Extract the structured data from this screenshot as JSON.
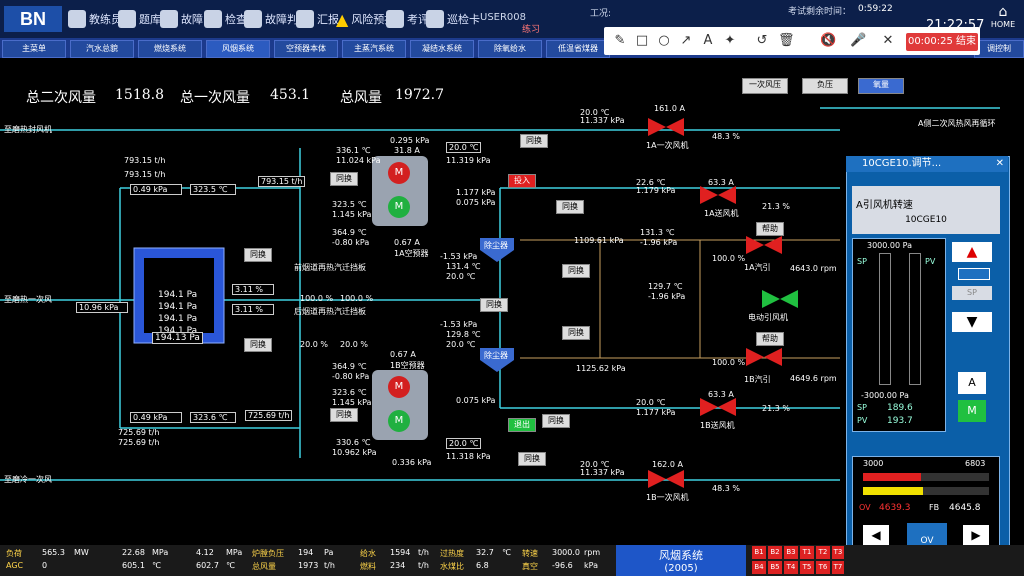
{
  "topbar": {
    "logo": "BN",
    "buttons": [
      "教练员站",
      "题库",
      "故障",
      "检查",
      "故障判断",
      "汇报",
      "风险预控",
      "考评",
      "巡检卡"
    ],
    "user": "USER008",
    "mode": "练习",
    "exam_label": "工况:",
    "remaining_label": "考试剩余时间：",
    "remaining": "0:59:22",
    "clock": "21:22:57",
    "home": "HOME"
  },
  "nav": [
    "主菜单",
    "汽水总貌",
    "燃烧系统",
    "风烟系统",
    "空预器本体",
    "主蒸汽系统",
    "凝结水系统",
    "除氧给水",
    "低温省煤器",
    "调控制"
  ],
  "annotation": {
    "timer": "00:00:25 结束"
  },
  "summary": {
    "sec_air_label": "总二次风量",
    "sec_air": "1518.8",
    "pri_air_label": "总一次风量",
    "pri_air": "453.1",
    "total_air_label": "总风量",
    "total_air": "1972.7"
  },
  "left_labels": [
    "至磨热封风机",
    "至磨热一次风",
    "至磨冷一次风"
  ],
  "values": {
    "flow1": "793.15 t/h",
    "flow2": "793.15 t/h",
    "flow3": "793.15 t/h",
    "p1": "0.49 kPa",
    "t1": "323.5 ℃",
    "p2": "10.96 kPa",
    "p3": "0.49 kPa",
    "t2": "323.6 ℃",
    "f4": "725.69 t/h",
    "f5": "725.69 t/h",
    "f6": "725.69 t/h",
    "box_vals": [
      "194.1 Pa",
      "194.1 Pa",
      "194.1 Pa",
      "194.1 Pa",
      "194.13 Pa"
    ],
    "pct1": "3.11 %",
    "pct2": "3.11 %",
    "ap_a_p": "0.295 kPa",
    "ap_a_pct": "31.8 A",
    "ap_a_t": "336.1 ℃",
    "ap_a_t2": "11.024 kPa",
    "ap_b_t": "330.6 ℃",
    "ap_b_p": "10.962 kPa",
    "ap_b_p2": "0.336 kPa",
    "mid1": "323.5 ℃",
    "mid2": "1.145 kPa",
    "mid3": "364.9 ℃",
    "mid4": "-0.80 kPa",
    "mid5": "364.9 ℃",
    "mid6": "-0.80 kPa",
    "mid7": "323.6 ℃",
    "mid8": "1.145 kPa",
    "a_amp": "0.67 A",
    "a_name": "1A空预器",
    "b_amp": "0.67 A",
    "b_name": "1B空预器",
    "damper_a": "前烟道再热汽迁挡板",
    "damper_b": "后烟道再热汽迁挡板",
    "dpct1": "100.0 %",
    "dpct2": "100.0 %",
    "dpct3": "20.0 %",
    "dpct4": "20.0 %",
    "r1": "20.0 ℃",
    "r2": "11.319 kPa",
    "r3": "1.177 kPa",
    "r4": "0.075 kPa",
    "r5": "-1.53 kPa",
    "r6": "131.4 ℃",
    "r7": "20.0 ℃",
    "r8": "-1.53 kPa",
    "r9": "129.8 ℃",
    "r10": "20.0 ℃",
    "r11": "0.075 kPa",
    "r12": "20.0 ℃",
    "r13": "11.318 kPa",
    "fan1_amp": "161.0 A",
    "fan1": "1A一次风机",
    "fan1_pct": "48.3 %",
    "fan1_t": "20.0 ℃",
    "fan1_p": "11.337 kPa",
    "fan2_amp": "63.3 A",
    "fan2": "1A送风机",
    "fan2_t": "22.6 ℃",
    "fan2_p": "1.179 kPa",
    "fan2_pct": "21.3 %",
    "fan3": "1A汽引",
    "fan3_pct": "100.0 %",
    "fan3_rpm": "4643.0 rpm",
    "fan3_t": "131.3 ℃",
    "fan3_p": "-1.96 kPa",
    "fan4": "电动引风机",
    "fan4_t": "129.7 ℃",
    "fan4_p": "-1.96 kPa",
    "fan5": "1B汽引",
    "fan5_pct": "100.0 %",
    "fan5_rpm": "4649.6 rpm",
    "fan6_amp": "63.3 A",
    "fan6": "1B送风机",
    "fan6_pct": "21.3 %",
    "fan6_t": "20.0 ℃",
    "fan6_p": "1.177 kPa",
    "fan7_amp": "162.0 A",
    "fan7": "1B一次风机",
    "fan7_pct": "48.3 %",
    "fan7_t": "20.0 ℃",
    "fan7_p": "11.337 kPa",
    "flow_mid": "1109.61 kPa",
    "flow_mid2": "1125.62 kPa",
    "dust1": "除尘器",
    "dust2": "除尘器",
    "top_btns": [
      "一次风压",
      "负压",
      "氧量"
    ],
    "right_note": "A侧二次风热风再循环"
  },
  "buttons": {
    "tongfa": "同换",
    "touru": "投入",
    "tuichu": "退出",
    "bangzhu": "帮助"
  },
  "faceplate": {
    "title": "10CGE10.调节...",
    "desc": "A引风机转速",
    "tag": "10CGE10",
    "sp_top": "3000.00 Pa",
    "sp_label": "SP",
    "pv_label": "PV",
    "sp_bottom": "-3000.00 Pa",
    "sp_val": "189.6",
    "pv_val": "193.7",
    "a_label": "A",
    "m_label": "M",
    "sp_btn": "SP",
    "range_min": "3000",
    "range_max": "6803",
    "ov_label": "OV",
    "ov_val": "4639.3",
    "fb_label": "FB",
    "fb_val": "4645.8",
    "ov_btn": "OV"
  },
  "status": {
    "load_label": "负荷",
    "load": "565.3",
    "load_unit": "MW",
    "agc_label": "AGC",
    "agc": "0",
    "p1": "22.68",
    "p1u": "MPa",
    "t1": "605.1",
    "t1u": "℃",
    "p2": "4.12",
    "p2u": "MPa",
    "t2": "602.7",
    "t2u": "℃",
    "furnace_label": "炉膛负压",
    "furnace": "194",
    "furnace_u": "Pa",
    "air_label": "总风量",
    "air": "1973",
    "air_u": "t/h",
    "water_label": "给水",
    "water": "1594",
    "water_u": "t/h",
    "coal_label": "燃料",
    "coal": "234",
    "coal_u": "t/h",
    "heat_label": "过热度",
    "heat": "32.7",
    "heat_u": "℃",
    "ratio_label": "水煤比",
    "ratio": "6.8",
    "speed_label": "转速",
    "speed": "3000.0",
    "speed_u": "rpm",
    "vac_label": "真空",
    "vac": "-96.6",
    "vac_u": "kPa",
    "system_name": "风烟系统",
    "system_code": "(2005)",
    "alarms": [
      "B1",
      "B2",
      "B3",
      "T1",
      "T2",
      "T3",
      "B4",
      "B5",
      "T4",
      "T5",
      "T6",
      "T7"
    ]
  }
}
